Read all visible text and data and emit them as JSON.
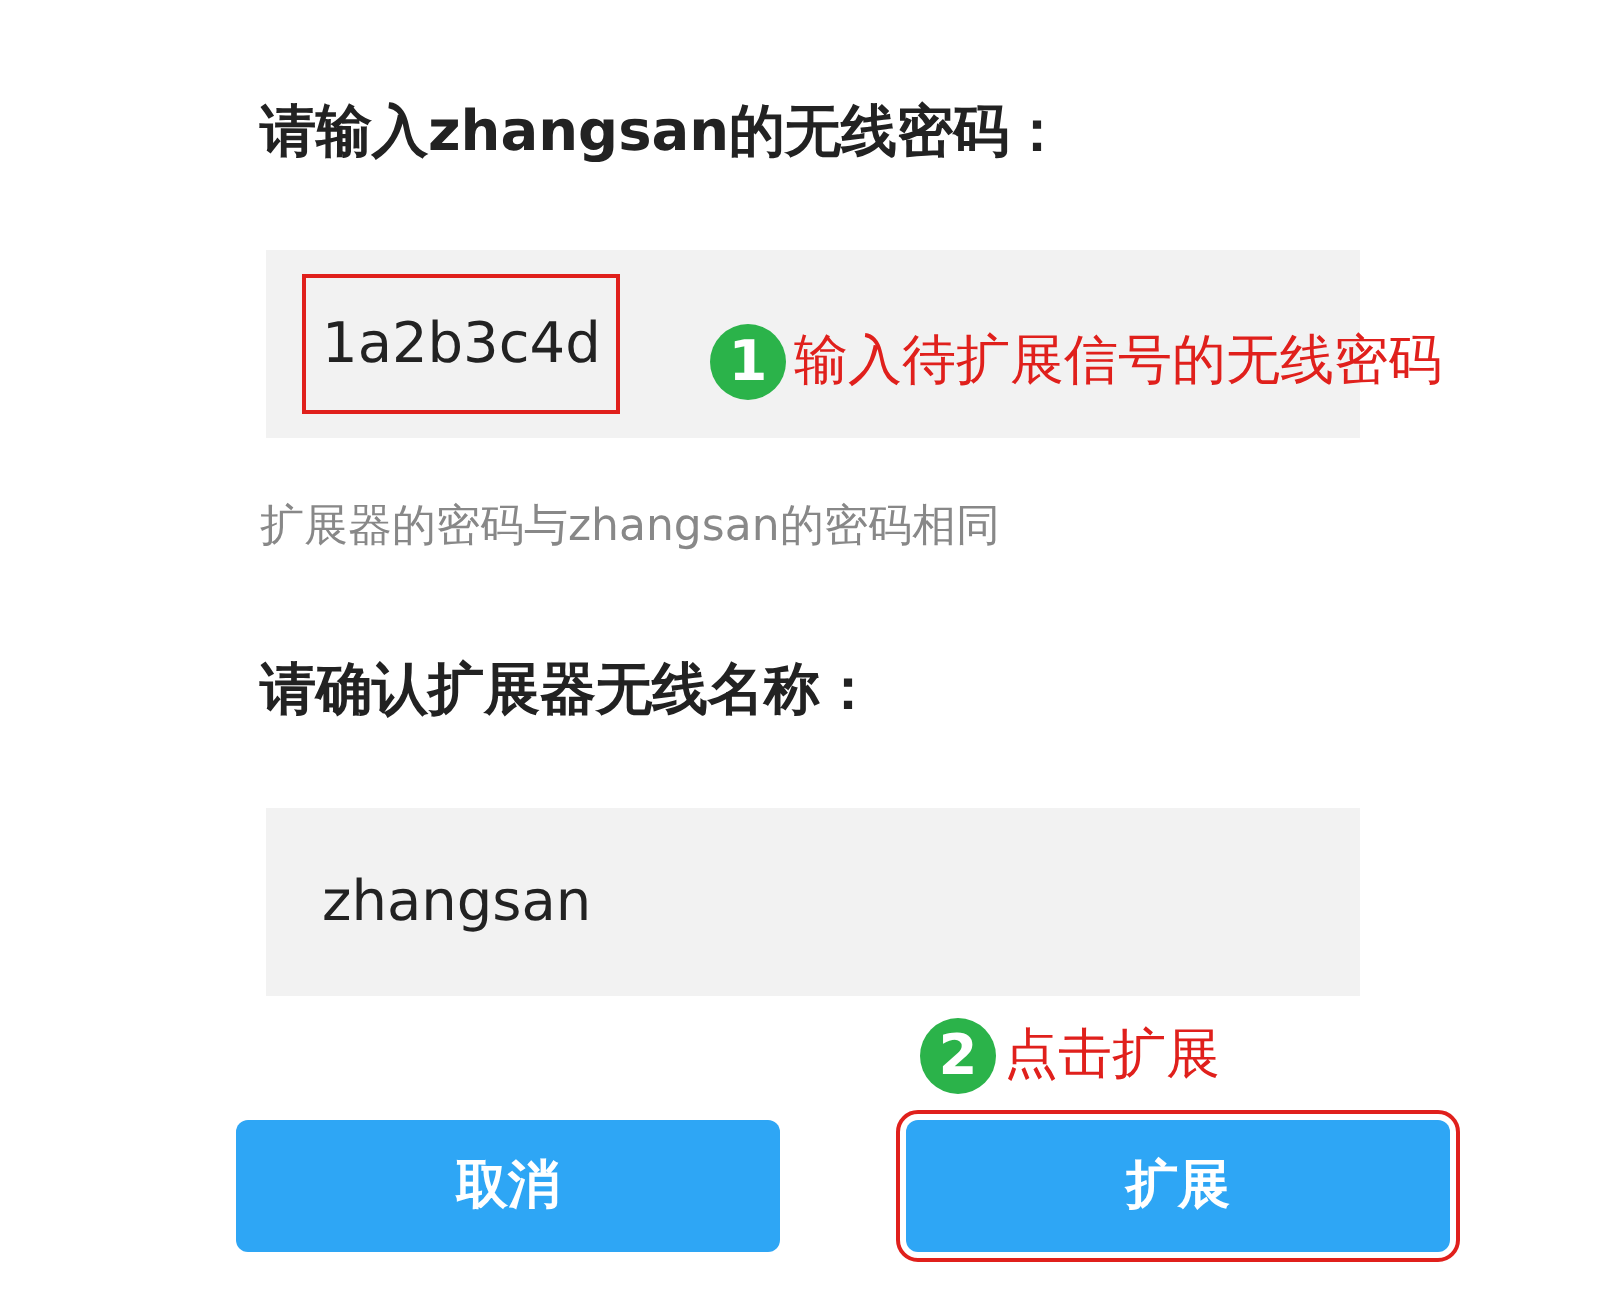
{
  "password_section": {
    "heading": "请输入zhangsan的无线密码：",
    "field": {
      "value": "1a2b3c4d",
      "highlighted": true
    },
    "annotation": {
      "number": "1",
      "text": "输入待扩展信号的无线密码"
    },
    "hint": "扩展器的密码与zhangsan的密码相同"
  },
  "name_section": {
    "heading": "请确认扩展器无线名称：",
    "field": {
      "value": "zhangsan",
      "highlighted": false
    }
  },
  "annotation": {
    "number": "2",
    "text": "点击扩展"
  },
  "buttons": [
    {
      "label": "取消",
      "highlighted": false
    },
    {
      "label": "扩展",
      "highlighted": true
    }
  ]
}
